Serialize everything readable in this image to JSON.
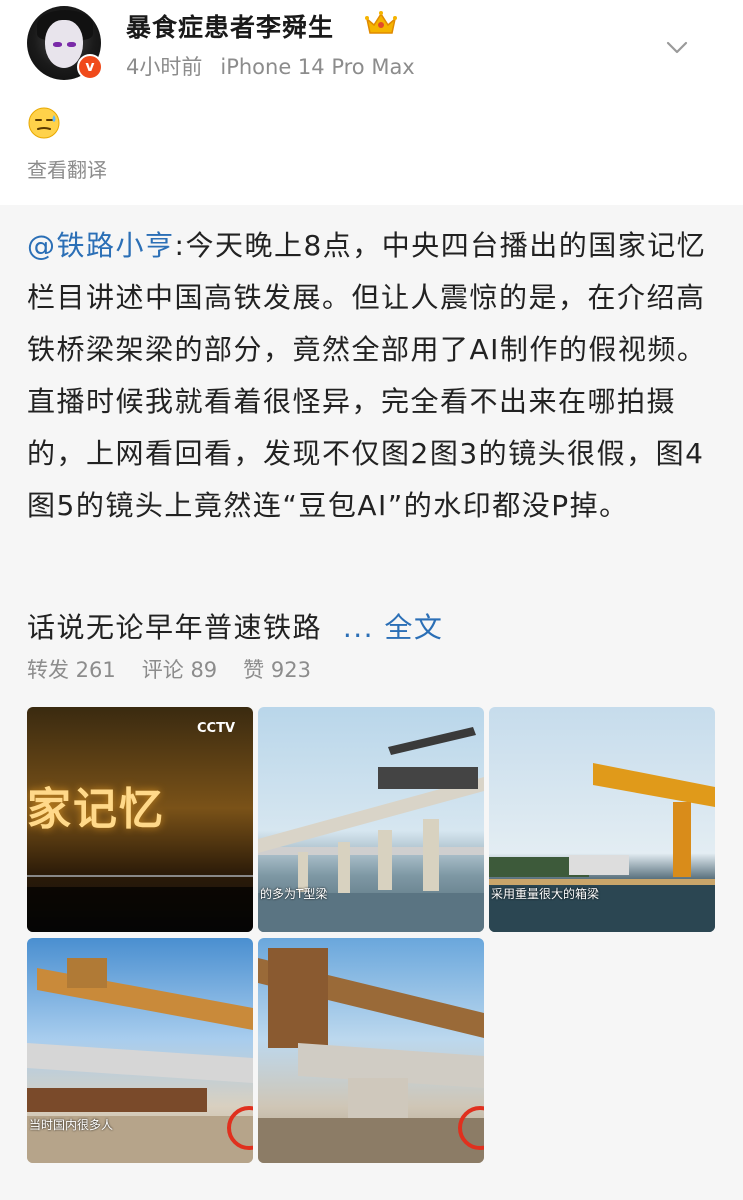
{
  "post": {
    "username": "暴食症患者李舜生",
    "time": "4小时前",
    "device": "iPhone 14 Pro Max",
    "verified_badge": "v",
    "emoji": "sweat-smile-emoji",
    "translate_label": "查看翻译"
  },
  "repost": {
    "mention": "@铁路小亨",
    "text": ":今天晚上8点，中央四台播出的国家记忆栏目讲述中国高铁发展。但让人震惊的是，在介绍高铁桥梁架梁的部分，竟然全部用了AI制作的假视频。直播时候我就看着很怪异，完全看不出来在哪拍摄的，上网看回看，发现不仅图2图3的镜头很假，图4图5的镜头上竟然连“豆包AI”的水印都没P掉。",
    "summary": "话说无论早年普速铁路",
    "more_label": "... 全文",
    "stats": {
      "repost": "转发 261",
      "comment": "评论 89",
      "like": "赞 923"
    }
  },
  "images": [
    {
      "caption": "家记忆",
      "logo": "CCTV"
    },
    {
      "caption": "的多为T型梁"
    },
    {
      "caption": "采用重量很大的箱梁"
    },
    {
      "caption": "当时国内很多人"
    },
    {
      "caption": ""
    }
  ],
  "colors": {
    "link": "#2b6fb6",
    "muted": "#8c8c8c",
    "badge": "#f04a1b",
    "repost_bg": "#f6f6f6"
  }
}
